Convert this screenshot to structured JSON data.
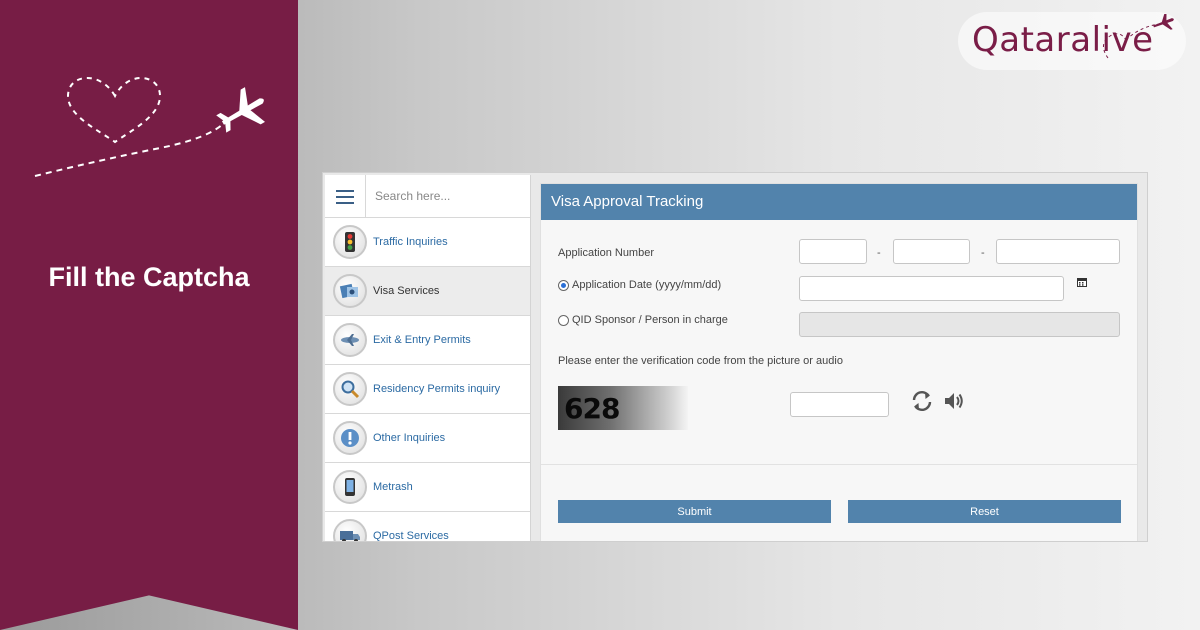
{
  "banner": {
    "title": "Fill the Captcha",
    "color": "#771d45"
  },
  "logo": {
    "text": "Qataralive",
    "color": "#7a1d47"
  },
  "sidebar": {
    "menu_icon": "hamburger-icon",
    "search_placeholder": "Search here...",
    "items": [
      {
        "label": "Traffic Inquiries",
        "icon": "traffic-light-icon"
      },
      {
        "label": "Visa Services",
        "icon": "visa-icon",
        "active": true
      },
      {
        "label": "Exit & Entry Permits",
        "icon": "airplane-icon"
      },
      {
        "label": "Residency Permits inquiry",
        "icon": "magnifier-icon"
      },
      {
        "label": "Other Inquiries",
        "icon": "info-icon"
      },
      {
        "label": "Metrash",
        "icon": "phone-icon"
      },
      {
        "label": "QPost Services",
        "icon": "truck-icon"
      }
    ]
  },
  "form": {
    "header": "Visa Approval Tracking",
    "header_color": "#5283ac",
    "application_number_label": "Application Number",
    "dash": "-",
    "application_date_label": "Application Date  (yyyy/mm/dd)",
    "qid_label": "QID Sponsor / Person in charge",
    "verification_text": "Please enter the verification code from the picture or audio",
    "captcha_code": "628",
    "submit_label": "Submit",
    "reset_label": "Reset"
  }
}
